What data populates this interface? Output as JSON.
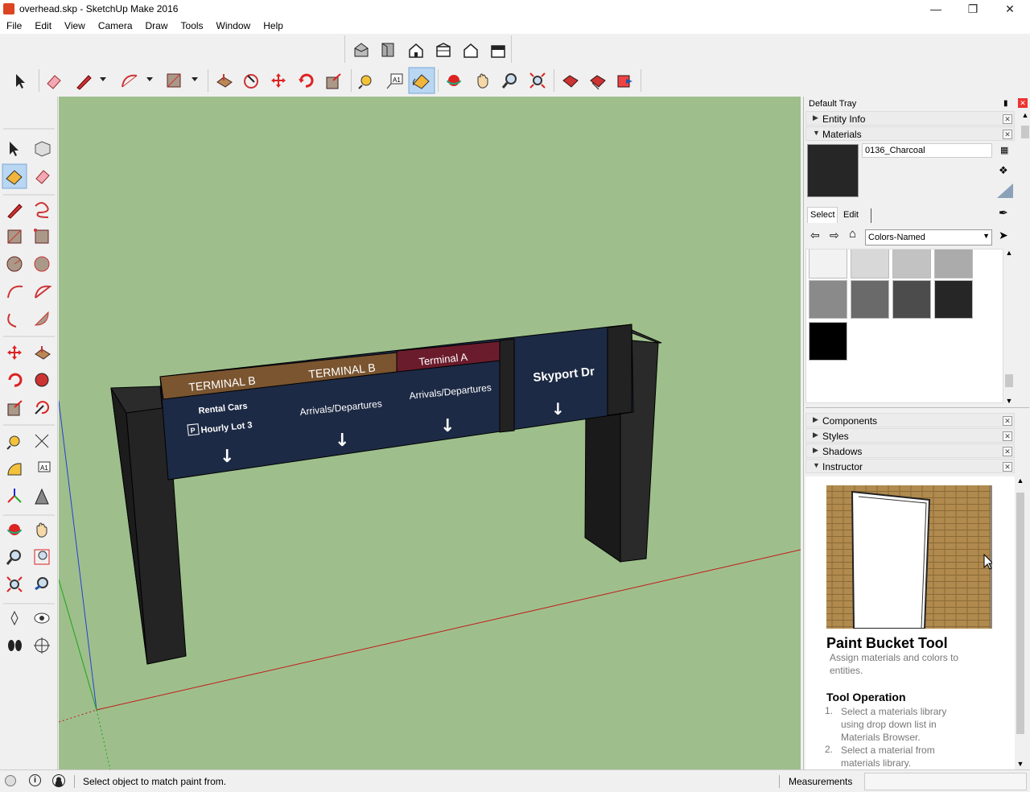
{
  "window": {
    "title": "overhead.skp - SketchUp Make 2016"
  },
  "menu": [
    "File",
    "Edit",
    "View",
    "Camera",
    "Draw",
    "Tools",
    "Window",
    "Help"
  ],
  "tray": {
    "title": "Default Tray",
    "panels": {
      "entity_info": "Entity Info",
      "materials": "Materials",
      "components": "Components",
      "styles": "Styles",
      "shadows": "Shadows",
      "instructor": "Instructor"
    },
    "materials": {
      "current_name": "0136_Charcoal",
      "tabs": [
        "Select",
        "Edit"
      ],
      "library": "Colors-Named",
      "swatch_colors": [
        "#f2f2f2",
        "#d8d8d8",
        "#c2c2c2",
        "#ababab",
        "#8a8a8a",
        "#6a6a6a",
        "#4c4c4c",
        "#262626",
        "#000000"
      ]
    },
    "instructor": {
      "tool_name": "Paint Bucket Tool",
      "description": "Assign materials and colors to entities.",
      "section": "Tool Operation",
      "steps": [
        "Select a materials library using drop down list in Materials Browser.",
        "Select a material from materials library."
      ]
    }
  },
  "sign": {
    "header_1": "TERMINAL  B",
    "header_2": "TERMINAL  B",
    "header_3": "Terminal  A",
    "header_4": "Skyport Dr",
    "body_1a": "Rental Cars",
    "body_1b": "Hourly Lot 3",
    "body_1p": "P",
    "body_2": "Arrivals/Departures",
    "body_3": "Arrivals/Departures",
    "arrow": "↓"
  },
  "status": {
    "message": "Select object to match paint from.",
    "measurements_label": "Measurements",
    "measurements_value": ""
  },
  "colors": {
    "viewport_bg": "#9ebf8c",
    "sign_navy": "#1d2a45",
    "header_brown": "#7a5530",
    "header_maroon": "#6b1c2c",
    "post": "#1f1f1f"
  }
}
